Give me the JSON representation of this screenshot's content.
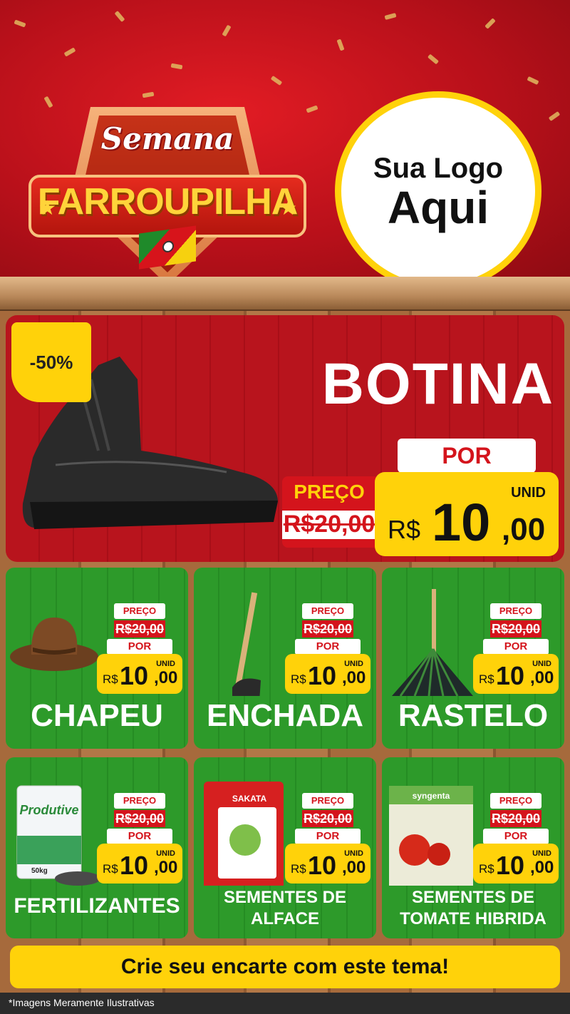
{
  "header": {
    "badge_top": "Semana",
    "badge_main": "FARROUPILHA",
    "logo_line1": "Sua Logo",
    "logo_line2": "Aqui"
  },
  "featured": {
    "discount": "-50%",
    "title": "BOTINA",
    "por_label": "POR",
    "preco_label": "PREÇO",
    "old_price": "R$20,00",
    "unit": "UNID",
    "currency": "R$",
    "price_int": "10",
    "price_dec": ",00"
  },
  "products": [
    {
      "name": "CHAPEU",
      "preco_label": "PREÇO",
      "old_price": "R$20,00",
      "por_label": "POR",
      "unit": "UNID",
      "currency": "R$",
      "price_int": "10",
      "price_dec": ",00",
      "icon": "hat-icon"
    },
    {
      "name": "ENCHADA",
      "preco_label": "PREÇO",
      "old_price": "R$20,00",
      "por_label": "POR",
      "unit": "UNID",
      "currency": "R$",
      "price_int": "10",
      "price_dec": ",00",
      "icon": "hoe-icon"
    },
    {
      "name": "RASTELO",
      "preco_label": "PREÇO",
      "old_price": "R$20,00",
      "por_label": "POR",
      "unit": "UNID",
      "currency": "R$",
      "price_int": "10",
      "price_dec": ",00",
      "icon": "rake-icon"
    },
    {
      "name": "FERTILIZANTES",
      "preco_label": "PREÇO",
      "old_price": "R$20,00",
      "por_label": "POR",
      "unit": "UNID",
      "currency": "R$",
      "price_int": "10",
      "price_dec": ",00",
      "icon": "fertilizer-bag-icon",
      "bag_brand": "Produtive",
      "bag_weight": "50kg"
    },
    {
      "name_line1": "SEMENTES DE",
      "name_line2": "ALFACE",
      "preco_label": "PREÇO",
      "old_price": "R$20,00",
      "por_label": "POR",
      "unit": "UNID",
      "currency": "R$",
      "price_int": "10",
      "price_dec": ",00",
      "icon": "seed-packet-icon",
      "pack_brand": "SAKATA"
    },
    {
      "name_line1": "SEMENTES DE",
      "name_line2": "TOMATE HIBRIDA",
      "preco_label": "PREÇO",
      "old_price": "R$20,00",
      "por_label": "POR",
      "unit": "UNID",
      "currency": "R$",
      "price_int": "10",
      "price_dec": ",00",
      "icon": "tomato-seed-packet-icon",
      "pack_brand": "syngenta"
    }
  ],
  "cta": "Crie seu encarte com este tema!",
  "footer": "*Imagens Meramente Ilustrativas",
  "colors": {
    "red": "#d4141c",
    "yellow": "#ffd20a",
    "green": "#2d9a2a",
    "wood": "#a66a3c"
  }
}
